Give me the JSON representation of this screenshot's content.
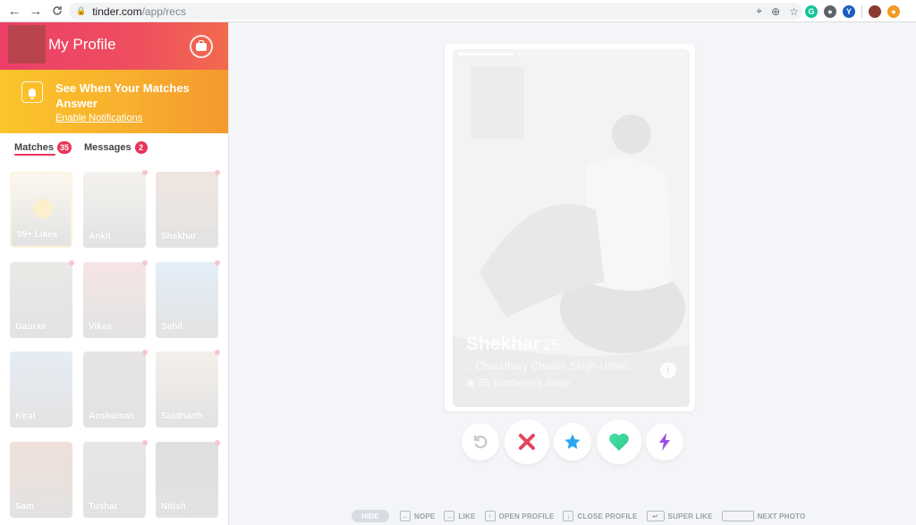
{
  "browser": {
    "url_host": "tinder.com",
    "url_path": "/app/recs",
    "nav": {
      "back": "←",
      "forward": "→",
      "reload": "C"
    },
    "omnibox_icons": [
      "location-icon",
      "zoom-icon",
      "star-icon"
    ],
    "extensions": [
      {
        "name": "grammarly-extension",
        "glyph": "G",
        "color": "#15c39a"
      },
      {
        "name": "extension-gray",
        "glyph": "●",
        "color": "#5f6368"
      },
      {
        "name": "extension-blue-v",
        "glyph": "Y",
        "color": "#1a5ec2"
      },
      {
        "name": "user-avatar",
        "glyph": "",
        "color": "#8b3a2f"
      },
      {
        "name": "extension-orange",
        "glyph": "●",
        "color": "#f29b22"
      }
    ]
  },
  "sidebar": {
    "profile_title": "My Profile",
    "notification": {
      "title": "See When Your Matches Answer",
      "link": "Enable Notifications"
    },
    "tabs": [
      {
        "label": "Matches",
        "count": "35",
        "active": true
      },
      {
        "label": "Messages",
        "count": "2",
        "active": false
      }
    ],
    "matches": [
      {
        "name": "99+ Likes",
        "color": "#f5e7c9",
        "new": false,
        "likes": true
      },
      {
        "name": "Ankit",
        "color": "#d8cfc2",
        "new": true
      },
      {
        "name": "Shekhar",
        "color": "#c7a48f",
        "new": true
      },
      {
        "name": "Gaurav",
        "color": "#b7b2a8",
        "new": true
      },
      {
        "name": "Vikas",
        "color": "#e1a3a3",
        "new": true
      },
      {
        "name": "Sahil",
        "color": "#9dc5e6",
        "new": true
      },
      {
        "name": "Kirat",
        "color": "#a9bfd8",
        "new": false
      },
      {
        "name": "Anshuman",
        "color": "#a8a39c",
        "new": true
      },
      {
        "name": "Siddharth",
        "color": "#d9c8b6",
        "new": true
      },
      {
        "name": "Sam",
        "color": "#c98f75",
        "new": false
      },
      {
        "name": "Tushar",
        "color": "#a9a9a9",
        "new": true
      },
      {
        "name": "Nitish",
        "color": "#8c8c8c",
        "new": true
      }
    ]
  },
  "card": {
    "name": "Shekhar",
    "age": "25",
    "school": "Chaudhary Charan Singh Unive...",
    "distance": "55 kilometers away",
    "info_glyph": "i"
  },
  "actions": [
    {
      "name": "rewind-button",
      "icon": "rewind-icon",
      "color": "#c8ccd0"
    },
    {
      "name": "nope-button",
      "icon": "x-icon",
      "color": "#e5445e"
    },
    {
      "name": "super-like-button",
      "icon": "star-icon",
      "color": "#2ba8f0"
    },
    {
      "name": "like-button",
      "icon": "heart-icon",
      "color": "#3fd8a0"
    },
    {
      "name": "boost-button",
      "icon": "lightning-icon",
      "color": "#9b4fe3"
    }
  ],
  "shortcuts": {
    "hide": "HIDE",
    "items": [
      {
        "key": "←",
        "label": "NOPE"
      },
      {
        "key": "→",
        "label": "LIKE"
      },
      {
        "key": "↑",
        "label": "OPEN PROFILE"
      },
      {
        "key": "↓",
        "label": "CLOSE PROFILE"
      },
      {
        "key": "↵",
        "label": "SUPER LIKE"
      },
      {
        "key": "",
        "label": "NEXT PHOTO"
      }
    ]
  },
  "colors": {
    "brand_pink": "#ec3e69",
    "notif_yellow": "#fbc52a",
    "badge_red": "#e8345a"
  }
}
